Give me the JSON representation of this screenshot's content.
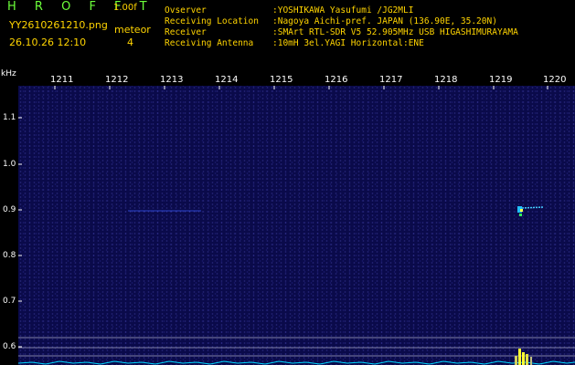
{
  "header": {
    "logo": "H R O F F T",
    "version": "1.00f",
    "filename": "YY2610261210.png",
    "datetime": "26.10.26 12:10",
    "meteor_label": "meteor",
    "meteor_count": "4"
  },
  "info": [
    {
      "label": "Ovserver",
      "value": ":YOSHIKAWA Yasufumi /JG2MLI"
    },
    {
      "label": "Receiving Location",
      "value": ":Nagoya Aichi-pref. JAPAN (136.90E, 35.20N)"
    },
    {
      "label": "Receiver",
      "value": ":SMArt RTL-SDR V5 52.905MHz USB HIGASHIMURAYAMA"
    },
    {
      "label": "Receiving Antenna",
      "value": ":10mH 3el.YAGI Horizontal:ENE"
    }
  ],
  "axis": {
    "unit": "kHz",
    "time_ticks": [
      "1211",
      "1212",
      "1213",
      "1214",
      "1215",
      "1216",
      "1217",
      "1218",
      "1219",
      "1220"
    ],
    "freq_ticks": [
      "1.1",
      "1.0",
      "0.9",
      "0.8",
      "0.7",
      "0.6"
    ]
  },
  "colors": {
    "background": "#000000",
    "spectrogram": "#0a0a4a",
    "logo": "#6cff3a",
    "text_yellow": "#ffd400",
    "trace": "#00d8ff",
    "echo": "#44ccff"
  }
}
